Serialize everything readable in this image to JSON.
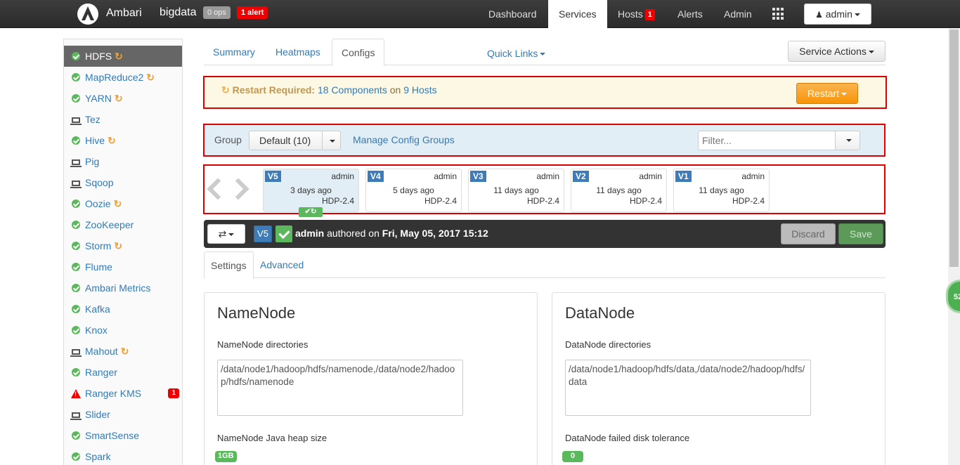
{
  "topbar": {
    "brand": "Ambari",
    "cluster_name": "bigdata",
    "ops_badge": "0 ops",
    "alert_badge": "1 alert",
    "nav": [
      {
        "label": "Dashboard"
      },
      {
        "label": "Services",
        "active": true
      },
      {
        "label": "Hosts",
        "count": "1"
      },
      {
        "label": "Alerts"
      },
      {
        "label": "Admin"
      }
    ],
    "user": "admin"
  },
  "sidebar": {
    "services": [
      {
        "name": "HDFS",
        "status": "ok",
        "restart": true,
        "active": true
      },
      {
        "name": "MapReduce2",
        "status": "ok",
        "restart": true
      },
      {
        "name": "YARN",
        "status": "ok",
        "restart": true
      },
      {
        "name": "Tez",
        "status": "client"
      },
      {
        "name": "Hive",
        "status": "ok",
        "restart": true
      },
      {
        "name": "Pig",
        "status": "client"
      },
      {
        "name": "Sqoop",
        "status": "client"
      },
      {
        "name": "Oozie",
        "status": "ok",
        "restart": true
      },
      {
        "name": "ZooKeeper",
        "status": "ok"
      },
      {
        "name": "Storm",
        "status": "ok",
        "restart": true
      },
      {
        "name": "Flume",
        "status": "ok"
      },
      {
        "name": "Ambari Metrics",
        "status": "ok"
      },
      {
        "name": "Kafka",
        "status": "ok"
      },
      {
        "name": "Knox",
        "status": "ok"
      },
      {
        "name": "Mahout",
        "status": "client",
        "restart": true
      },
      {
        "name": "Ranger",
        "status": "ok"
      },
      {
        "name": "Ranger KMS",
        "status": "alert",
        "alert_count": "1"
      },
      {
        "name": "Slider",
        "status": "client"
      },
      {
        "name": "SmartSense",
        "status": "ok"
      },
      {
        "name": "Spark",
        "status": "ok"
      }
    ]
  },
  "tabs": {
    "summary": "Summary",
    "heatmaps": "Heatmaps",
    "configs": "Configs",
    "quick_links": "Quick Links",
    "service_actions": "Service Actions"
  },
  "restart": {
    "label": "Restart Required:",
    "components": "18 Components",
    "on": "on",
    "hosts": "9 Hosts",
    "button": "Restart"
  },
  "group_bar": {
    "label": "Group",
    "selected": "Default (10)",
    "manage": "Manage Config Groups",
    "filter_placeholder": "Filter..."
  },
  "versions": [
    {
      "label": "V5",
      "user": "admin",
      "date": "3 days ago",
      "stack": "HDP-2.4",
      "current": true
    },
    {
      "label": "V4",
      "user": "admin",
      "date": "5 days ago",
      "stack": "HDP-2.4"
    },
    {
      "label": "V3",
      "user": "admin",
      "date": "11 days ago",
      "stack": "HDP-2.4"
    },
    {
      "label": "V2",
      "user": "admin",
      "date": "11 days ago",
      "stack": "HDP-2.4"
    },
    {
      "label": "V1",
      "user": "admin",
      "date": "11 days ago",
      "stack": "HDP-2.4"
    }
  ],
  "version_bar": {
    "tag": "V5",
    "author": "admin",
    "authored_on": "authored on",
    "date": "Fri, May 05, 2017 15:12",
    "discard": "Discard",
    "save": "Save"
  },
  "settings_tabs": {
    "settings": "Settings",
    "advanced": "Advanced"
  },
  "namenode": {
    "title": "NameNode",
    "dirs_label": "NameNode directories",
    "dirs_value": "/data/node1/hadoop/hdfs/namenode,/data/node2/hadoop/hdfs/namenode",
    "heap_label": "NameNode Java heap size",
    "heap_value": "1GB"
  },
  "datanode": {
    "title": "DataNode",
    "dirs_label": "DataNode directories",
    "dirs_value": "/data/node1/hadoop/hdfs/data,/data/node2/hadoop/hdfs/data",
    "tolerance_label": "DataNode failed disk tolerance",
    "tolerance_value": "0"
  },
  "float_widget": "52"
}
